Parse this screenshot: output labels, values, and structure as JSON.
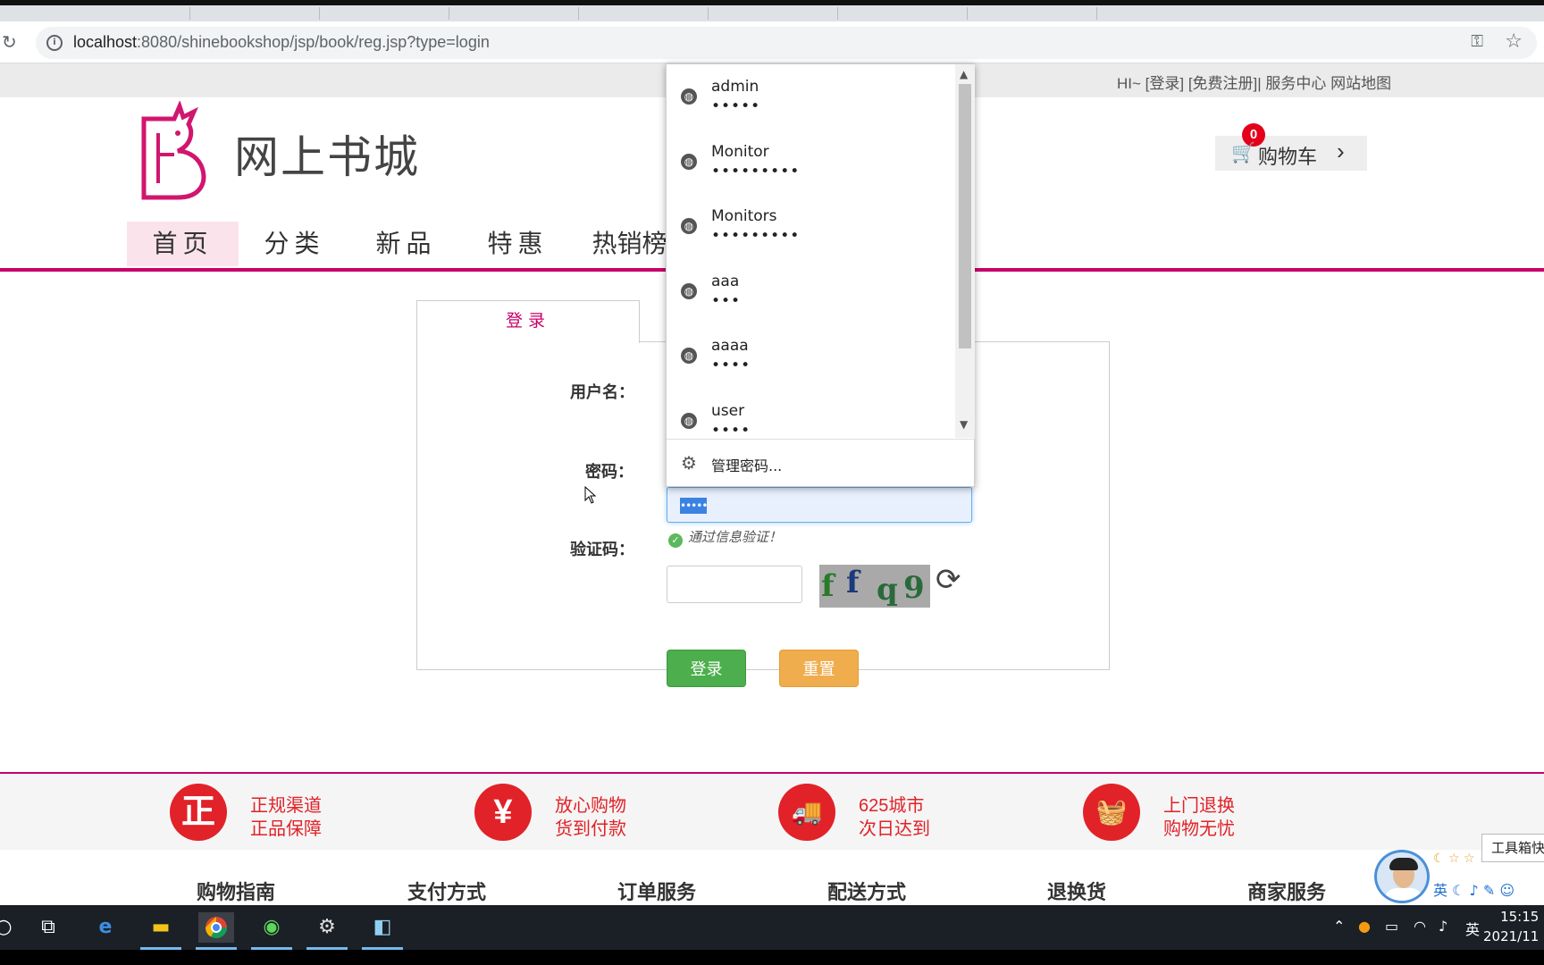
{
  "browser": {
    "url_host": "localhost",
    "url_rest": ":8080/shinebookshop/jsp/book/reg.jsp?type=login"
  },
  "topbar": {
    "links": "HI~ [登录] [免费注册]| 服务中心 网站地图"
  },
  "header": {
    "site_name": "网上书城",
    "cart_label": "购物车",
    "cart_count": "0"
  },
  "nav": {
    "items": [
      {
        "label": "首页",
        "active": true
      },
      {
        "label": "分类"
      },
      {
        "label": "新品"
      },
      {
        "label": "特惠"
      },
      {
        "label": "热销榜"
      }
    ]
  },
  "login": {
    "tab_label": "登录",
    "username_label": "用户名：",
    "password_label": "密码：",
    "password_value": "•••••",
    "password_ok_msg": "通过信息验证！",
    "captcha_label": "验证码：",
    "captcha_chars": [
      "f",
      "f",
      "q",
      "9"
    ],
    "login_button": "登录",
    "reset_button": "重置"
  },
  "autofill": {
    "entries": [
      {
        "user": "admin",
        "dots": "•••••"
      },
      {
        "user": "Monitor",
        "dots": "•••••••••"
      },
      {
        "user": "Monitors",
        "dots": "•••••••••"
      },
      {
        "user": "aaa",
        "dots": "•••"
      },
      {
        "user": "aaaa",
        "dots": "••••"
      },
      {
        "user": "user",
        "dots": "••••"
      }
    ],
    "manage_label": "管理密码..."
  },
  "guarantees": [
    {
      "icon": "正",
      "line1": "正规渠道",
      "line2": "正品保障"
    },
    {
      "icon": "¥",
      "line1": "放心购物",
      "line2": "货到付款"
    },
    {
      "icon": "truck-icon",
      "line1": "625城市",
      "line2": "次日达到"
    },
    {
      "icon": "basket-icon",
      "line1": "上门退换",
      "line2": "购物无忧"
    }
  ],
  "footer_columns": [
    "购物指南",
    "支付方式",
    "订单服务",
    "配送方式",
    "退换货",
    "商家服务"
  ],
  "taskbar": {
    "clock_time": "15:15",
    "clock_date": "2021/11",
    "ime": "英"
  },
  "qq": {
    "toolbox_label": "工具箱快",
    "ime_label": "英"
  },
  "colors": {
    "brand": "#c8006a",
    "success": "#4cae4c",
    "warning": "#f0ad4e",
    "guarantee_red": "#e12228"
  }
}
